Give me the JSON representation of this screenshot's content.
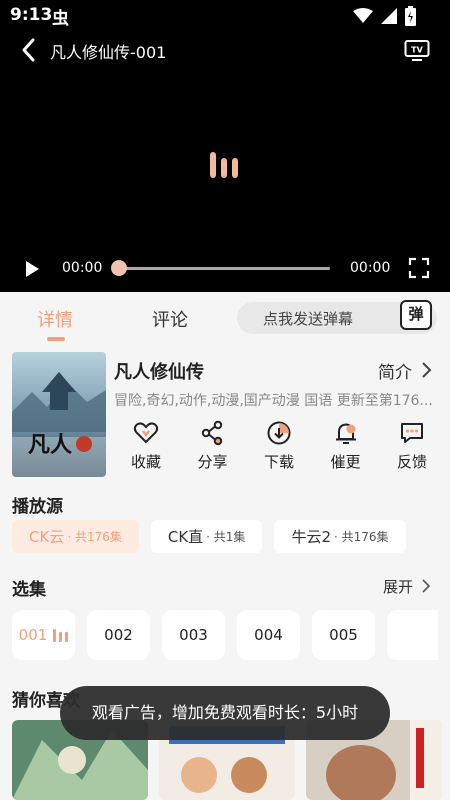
{
  "status": {
    "time": "9:13",
    "bug_glyph": "虫"
  },
  "player": {
    "title": "凡人修仙传-001",
    "current_time": "00:00",
    "total_time": "00:00",
    "progress": 0
  },
  "tabs": {
    "detail": "详情",
    "comment": "评论"
  },
  "danmu": {
    "placeholder": "点我发送弹幕",
    "button": "弹"
  },
  "show": {
    "title": "凡人修仙传",
    "intro": "简介",
    "meta": "冒险,奇幻,动作,动漫,国产动漫 国语 更新至第176...",
    "poster_text": "凡人"
  },
  "actions": [
    {
      "label": "收藏",
      "icon": "heart-icon"
    },
    {
      "label": "分享",
      "icon": "share-icon"
    },
    {
      "label": "下载",
      "icon": "download-icon"
    },
    {
      "label": "催更",
      "icon": "bell-icon"
    },
    {
      "label": "反馈",
      "icon": "feedback-icon"
    }
  ],
  "sources_title": "播放源",
  "sources": [
    {
      "name": "CK云",
      "count": "· 共176集",
      "active": true
    },
    {
      "name": "CK直",
      "count": "· 共1集",
      "active": false
    },
    {
      "name": "牛云2",
      "count": "· 共176集",
      "active": false
    }
  ],
  "episodes_title": "选集",
  "expand": "展开",
  "episodes": [
    "001",
    "002",
    "003",
    "004",
    "005"
  ],
  "recommend_title": "猜你喜欢",
  "toast": "观看广告，增加免费观看时长：5小时",
  "colors": {
    "accent": "#f0a07e",
    "player_bg": "#000000"
  }
}
